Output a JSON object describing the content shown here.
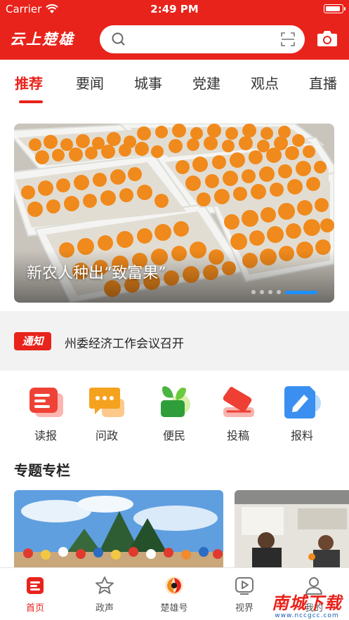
{
  "status_bar": {
    "carrier": "Carrier",
    "time": "2:49 PM"
  },
  "header": {
    "logo_text": "云上楚雄",
    "search": {
      "placeholder": ""
    },
    "accent_color": "#e8231b"
  },
  "tabs": [
    {
      "label": "推荐",
      "active": true
    },
    {
      "label": "要闻",
      "active": false
    },
    {
      "label": "城事",
      "active": false
    },
    {
      "label": "党建",
      "active": false
    },
    {
      "label": "观点",
      "active": false
    },
    {
      "label": "直播",
      "active": false
    }
  ],
  "banner": {
    "caption": "新农人种出“致富果”",
    "slide_count": 5,
    "active_index": 4
  },
  "notice": {
    "badge": "通知",
    "text": "州委经济工作会议召开"
  },
  "entries": [
    {
      "label": "读报",
      "icon": "newspaper-icon"
    },
    {
      "label": "问政",
      "icon": "chat-bubble-icon"
    },
    {
      "label": "便民",
      "icon": "plant-icon"
    },
    {
      "label": "投稿",
      "icon": "submit-icon"
    },
    {
      "label": "报料",
      "icon": "report-icon"
    }
  ],
  "columns": {
    "title": "专题专栏"
  },
  "bottom_nav": [
    {
      "label": "首页",
      "icon": "home-news-icon",
      "active": true
    },
    {
      "label": "政声",
      "icon": "star-icon",
      "active": false
    },
    {
      "label": "楚雄号",
      "icon": "chuxiong-logo-icon",
      "active": false
    },
    {
      "label": "视界",
      "icon": "play-icon",
      "active": false
    },
    {
      "label": "我的",
      "icon": "profile-icon",
      "active": false
    }
  ],
  "watermark": {
    "main": "南城下载",
    "sub": "www.nccgcc.com"
  }
}
